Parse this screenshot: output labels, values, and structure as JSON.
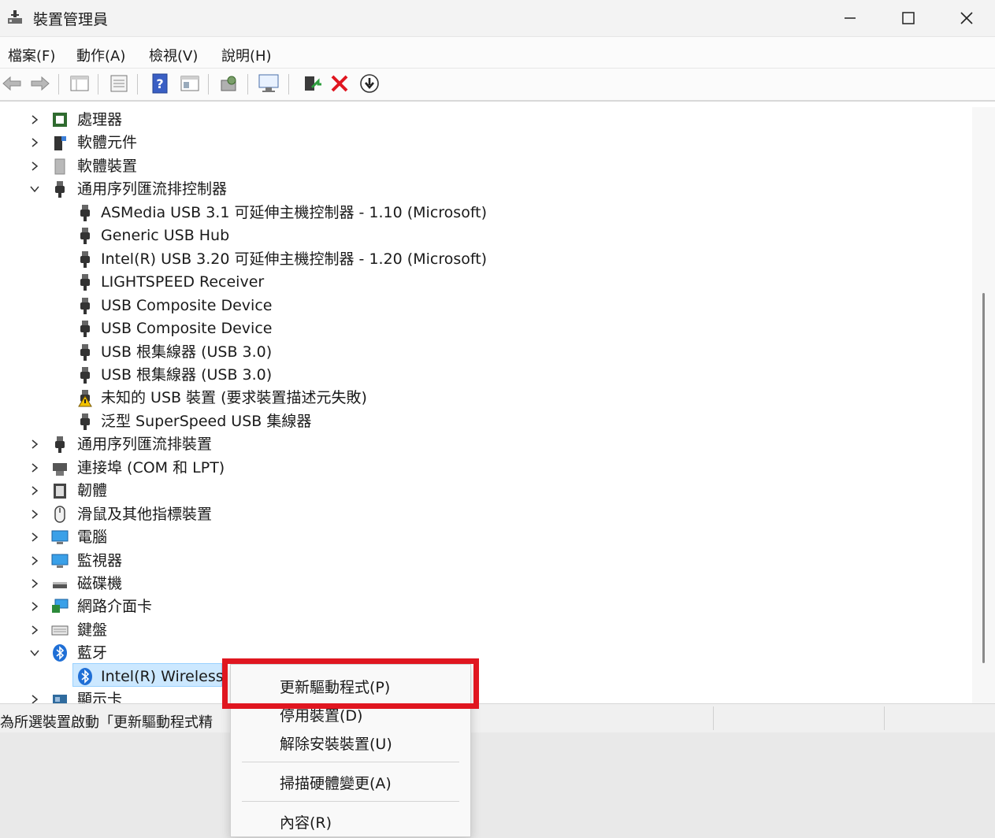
{
  "window": {
    "title": "裝置管理員",
    "controls": {
      "minimize": "minimize-icon",
      "maximize": "maximize-icon",
      "close": "close-icon"
    }
  },
  "menu": [
    "檔案(F)",
    "動作(A)",
    "檢視(V)",
    "說明(H)"
  ],
  "toolbar": [
    "back-arrow-icon",
    "forward-arrow-icon",
    "show-hide-tree-icon",
    "properties-icon",
    "help-icon",
    "view-icon",
    "scan-changes-icon",
    "monitor-icon",
    "update-driver-icon",
    "uninstall-icon",
    "disable-icon"
  ],
  "tree": [
    {
      "label": "處理器",
      "expanded": false,
      "icon": "processor-icon"
    },
    {
      "label": "軟體元件",
      "expanded": false,
      "icon": "software-component-icon"
    },
    {
      "label": "軟體裝置",
      "expanded": false,
      "icon": "software-device-icon"
    },
    {
      "label": "通用序列匯流排控制器",
      "expanded": true,
      "icon": "usb-icon"
    },
    {
      "label": "ASMedia USB 3.1 可延伸主機控制器 - 1.10 (Microsoft)",
      "child": true,
      "icon": "usb-icon"
    },
    {
      "label": "Generic USB Hub",
      "child": true,
      "icon": "usb-icon"
    },
    {
      "label": "Intel(R) USB 3.20 可延伸主機控制器 - 1.20 (Microsoft)",
      "child": true,
      "icon": "usb-icon"
    },
    {
      "label": "LIGHTSPEED Receiver",
      "child": true,
      "icon": "usb-icon"
    },
    {
      "label": "USB Composite Device",
      "child": true,
      "icon": "usb-icon"
    },
    {
      "label": "USB Composite Device",
      "child": true,
      "icon": "usb-icon"
    },
    {
      "label": "USB 根集線器 (USB 3.0)",
      "child": true,
      "icon": "usb-icon"
    },
    {
      "label": "USB 根集線器 (USB 3.0)",
      "child": true,
      "icon": "usb-icon"
    },
    {
      "label": "未知的 USB 裝置 (要求裝置描述元失敗)",
      "child": true,
      "icon": "warning-icon"
    },
    {
      "label": "泛型 SuperSpeed USB 集線器",
      "child": true,
      "icon": "usb-icon"
    },
    {
      "label": "通用序列匯流排裝置",
      "expanded": false,
      "icon": "usb-icon"
    },
    {
      "label": "連接埠 (COM 和 LPT)",
      "expanded": false,
      "icon": "port-icon"
    },
    {
      "label": "韌體",
      "expanded": false,
      "icon": "firmware-icon"
    },
    {
      "label": "滑鼠及其他指標裝置",
      "expanded": false,
      "icon": "mouse-icon"
    },
    {
      "label": "電腦",
      "expanded": false,
      "icon": "computer-icon"
    },
    {
      "label": "監視器",
      "expanded": false,
      "icon": "monitor-icon"
    },
    {
      "label": "磁碟機",
      "expanded": false,
      "icon": "disk-drive-icon"
    },
    {
      "label": "網路介面卡",
      "expanded": false,
      "icon": "network-adapter-icon"
    },
    {
      "label": "鍵盤",
      "expanded": false,
      "icon": "keyboard-icon"
    },
    {
      "label": "藍牙",
      "expanded": true,
      "icon": "bluetooth-icon"
    },
    {
      "label": "Intel(R) Wireless",
      "child": true,
      "icon": "bluetooth-icon",
      "selected": true
    },
    {
      "label": "顯示卡",
      "expanded": false,
      "icon": "display-adapter-icon"
    }
  ],
  "status": {
    "text": "為所選裝置啟動「更新驅動程式精"
  },
  "context_menu": {
    "items": [
      "更新驅動程式(P)",
      "停用裝置(D)",
      "解除安裝裝置(U)",
      "掃描硬體變更(A)",
      "內容(R)"
    ]
  },
  "colors": {
    "highlight": "#e01620",
    "selection": "#cce8ff",
    "accent": "#0a64c8"
  }
}
